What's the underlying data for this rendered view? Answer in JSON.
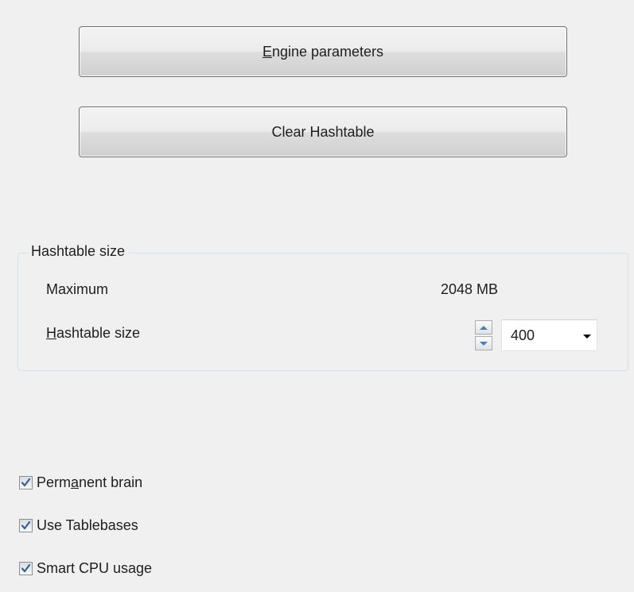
{
  "buttons": {
    "engine_parameters": {
      "mnemonic": "E",
      "rest": "ngine parameters"
    },
    "clear_hashtable": {
      "label": "Clear Hashtable"
    }
  },
  "hashtable_group": {
    "title": "Hashtable size",
    "maximum_label": "Maximum",
    "maximum_value": "2048 MB",
    "size_label": {
      "mnemonic": "H",
      "rest": "ashtable size"
    },
    "size_value": "400"
  },
  "checkboxes": [
    {
      "label_before": "Perm",
      "mnemonic": "a",
      "label_after": "nent brain",
      "checked": true
    },
    {
      "label_before": "Use Tablebases",
      "mnemonic": "",
      "label_after": "",
      "checked": true
    },
    {
      "label_before": "Smart CPU usage",
      "mnemonic": "",
      "label_after": "",
      "checked": true
    }
  ],
  "icons": {
    "spin_up": "triangle-up",
    "spin_down": "triangle-down",
    "dropdown": "triangle-down",
    "checkbox": "checkmark"
  },
  "colors": {
    "background": "#f0f0f0",
    "checkmark": "#2c62a8",
    "spin_arrow": "#4a7fb3"
  }
}
